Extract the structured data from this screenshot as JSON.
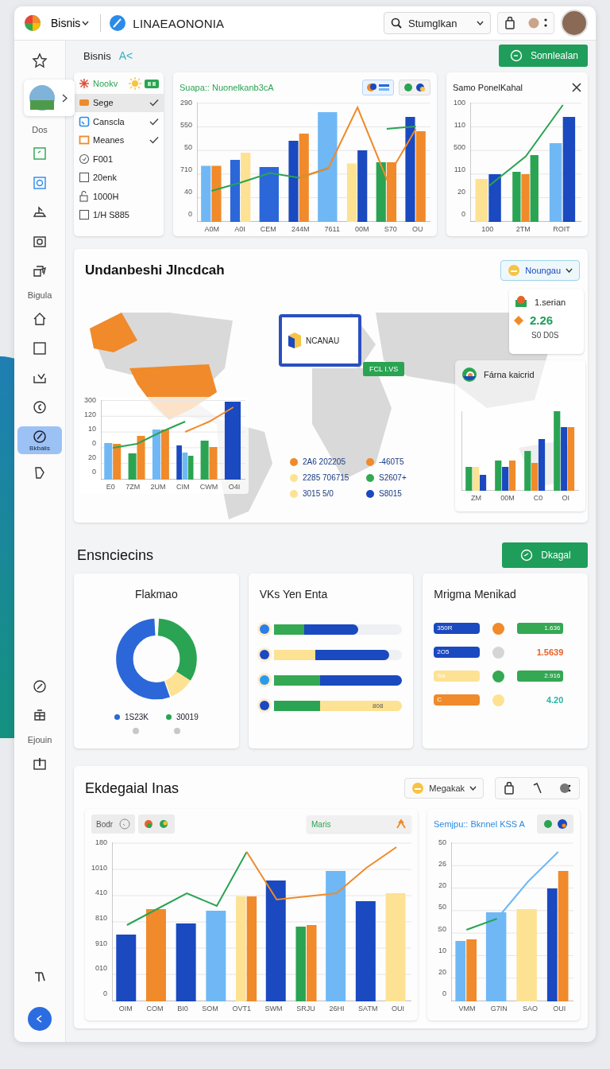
{
  "header": {
    "workspace": "Bisnis",
    "title": "LINAEAONONIA",
    "search": {
      "value": "Stumglkan"
    }
  },
  "sidebar": {
    "groups": [
      [
        {
          "kind": "icon",
          "selected": false
        },
        {
          "kind": "avatar",
          "selected": false
        },
        {
          "kind": "label",
          "text": "Dos"
        },
        {
          "kind": "icon",
          "selected": false
        },
        {
          "kind": "icon",
          "selected": false
        },
        {
          "kind": "icon",
          "selected": false
        },
        {
          "kind": "icon",
          "selected": false
        },
        {
          "kind": "icon",
          "selected": false
        },
        {
          "kind": "label",
          "text": "Bigula"
        },
        {
          "kind": "icon",
          "selected": false
        },
        {
          "kind": "icon",
          "selected": false
        },
        {
          "kind": "icon",
          "selected": false
        },
        {
          "kind": "icon",
          "selected": false
        },
        {
          "kind": "icon",
          "selected": true,
          "text": "Bkbaiis"
        },
        {
          "kind": "icon",
          "selected": false
        }
      ],
      [
        {
          "kind": "icon",
          "selected": false
        },
        {
          "kind": "icon",
          "selected": false
        },
        {
          "kind": "label",
          "text": "Ejouin"
        },
        {
          "kind": "icon",
          "selected": false
        }
      ],
      [
        {
          "kind": "icon",
          "selected": false
        },
        {
          "kind": "fab",
          "selected": false
        }
      ]
    ]
  },
  "breadcrumb": {
    "label": "Bisnis",
    "suffix": "A<"
  },
  "primary_button": "Sonnlealan",
  "filter": {
    "title": "Nookv",
    "items": [
      {
        "label": "Sege",
        "selected": true,
        "checked": true
      },
      {
        "label": "Canscla",
        "selected": false,
        "checked": true
      },
      {
        "label": "Meanes",
        "selected": false,
        "checked": true
      },
      {
        "label": "F001",
        "selected": false,
        "checked": false
      },
      {
        "label": "20enk",
        "selected": false,
        "checked": false
      },
      {
        "label": "1000H",
        "selected": false,
        "checked": false
      },
      {
        "label": "1/H S885",
        "selected": false,
        "checked": false
      }
    ]
  },
  "top_charts": [
    {
      "title": "Suapa:: Nuonelkanb3cA",
      "y_labels": [
        "290",
        "550",
        "50",
        "710",
        "40",
        "0"
      ],
      "x_labels": [
        "A0M",
        "A0I",
        "CEM",
        "244M",
        "7611",
        "00M",
        "S70",
        "OU"
      ]
    },
    {
      "title": "Samo PonelKahal",
      "y_labels": [
        "100",
        "110",
        "500",
        "110",
        "20",
        "0"
      ],
      "x_labels": [
        "100",
        "2TM",
        "ROIT"
      ]
    }
  ],
  "map_section": {
    "title": "Undanbeshi JIncdcah",
    "dropdown": "Noungau",
    "stat": {
      "label": "1.serian",
      "value": "2.26",
      "caption": "S0 D0S"
    },
    "package": "NCANAU",
    "tag": "FCL I.VS",
    "mini_chart": {
      "y_labels": [
        "300",
        "120",
        "10",
        "0",
        "20",
        "0"
      ],
      "x_labels": [
        "E0",
        "7ZM",
        "2UM",
        "CIM",
        "CWM",
        "O4I"
      ]
    },
    "legend": [
      {
        "text": "2A6 202205",
        "color": "#f08a2a"
      },
      {
        "text": "-460T5",
        "color": "#f08a2a"
      },
      {
        "text": "2285 706715",
        "color": "#fde293"
      },
      {
        "text": "S2607+",
        "color": "#34a853"
      },
      {
        "text": "3015 5/0",
        "color": "#fde293"
      },
      {
        "text": "S8015",
        "color": "#1a49c0"
      }
    ],
    "region_panel": {
      "title": "Fárna kaicrid",
      "x_labels": [
        "ZM",
        "00M",
        "C0",
        "OI"
      ]
    }
  },
  "summary": {
    "title": "Ensnciecins",
    "button": "Dkagal",
    "donut_card": {
      "title": "Flakmao",
      "legend": [
        {
          "text": "1S23K",
          "color": "#2b67d9"
        },
        {
          "text": "30019",
          "color": "#2aa452"
        }
      ]
    },
    "bars_card": {
      "title": "VKs Yen Enta",
      "rows": [
        {
          "color": "#2b7de9",
          "level": 0.66,
          "fill": {
            "color": "#1a49c0"
          },
          "lead": {
            "color": "#34a853"
          }
        },
        {
          "color": "#1a49c0",
          "level": 0.9,
          "fill": {
            "color": "#1a49c0"
          },
          "lead": {
            "color": "#fde293"
          }
        },
        {
          "color": "#2b9be9",
          "level": 1.0,
          "fill": {
            "color": "#1a49c0"
          },
          "lead": {
            "color": "#34a853"
          }
        },
        {
          "color": "#1a49c0",
          "level": 1.0,
          "fill": {
            "color": "#fde293"
          },
          "lead": {
            "color": "#2aa452"
          },
          "text": "808"
        }
      ]
    },
    "pills_card": {
      "title": "Mrigma Menikad",
      "rows": [
        {
          "left": {
            "text": "350R",
            "color": "#1a49c0"
          },
          "dot": {
            "color": "#f08a2a"
          },
          "right": {
            "kind": "pill",
            "text": "1.636",
            "color": "#34a853"
          }
        },
        {
          "left": {
            "text": "2O5",
            "color": "#1a49c0"
          },
          "dot": {
            "color": "#d5d5d5"
          },
          "right": {
            "kind": "plain",
            "text": "1.5639",
            "color": "#e8622a"
          }
        },
        {
          "left": {
            "text": "Sa",
            "color": "#fde293"
          },
          "dot": {
            "color": "#34a853"
          },
          "right": {
            "kind": "pill",
            "text": "2.916",
            "color": "#34a853"
          }
        },
        {
          "left": {
            "text": "C",
            "color": "#f08a2a"
          },
          "dot": {
            "color": "#fde293"
          },
          "right": {
            "kind": "plain",
            "text": "4.20",
            "color": "#2bb3a0"
          }
        }
      ]
    }
  },
  "trends": {
    "title": "Ekdegaial Inas",
    "dropdown": "Megakak",
    "main_chart": {
      "chip": "Bodr",
      "field": "Maris",
      "y_labels": [
        "180",
        "1010",
        "410",
        "810",
        "910",
        "010",
        "0"
      ],
      "x_labels": [
        "OIM",
        "COM",
        "BI0",
        "SOM",
        "OVT1",
        "SWM",
        "SRJU",
        "26HI",
        "SATM",
        "OUI"
      ]
    },
    "side_chart": {
      "title": "Semjpu:: Bknnel KSS A",
      "y_labels": [
        "50",
        "26",
        "20",
        "50",
        "S0",
        "10",
        "20",
        "0"
      ],
      "x_labels": [
        "VMM",
        "G7IN",
        "SAO",
        "OUI"
      ]
    }
  }
}
